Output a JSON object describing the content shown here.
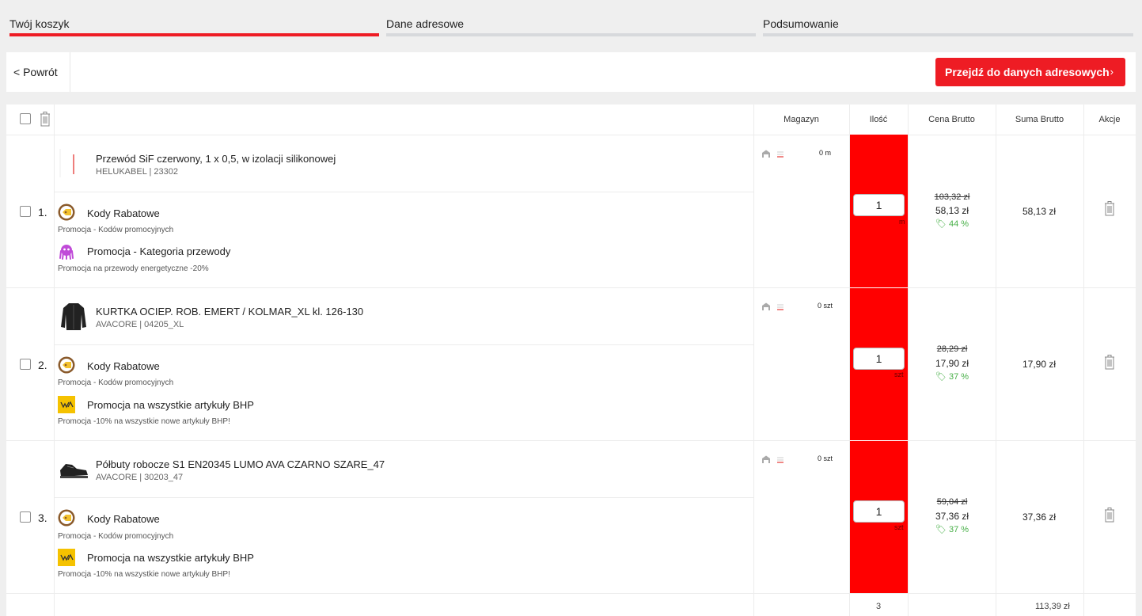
{
  "steps": [
    {
      "label": "Twój koszyk",
      "active": true
    },
    {
      "label": "Dane adresowe",
      "active": false
    },
    {
      "label": "Podsumowanie",
      "active": false
    }
  ],
  "toolbar": {
    "back_label": "< Powrót",
    "next_label": "Przejdź do danych adresowych",
    "next_icon": "chevron-right-icon"
  },
  "table": {
    "headers": {
      "stock": "Magazyn",
      "qty": "Ilość",
      "price": "Cena Brutto",
      "sum": "Suma Brutto",
      "actions": "Akcje"
    },
    "rows": [
      {
        "num": "1.",
        "name": "Przewód SiF czerwony, 1 x 0,5, w izolacji silikonowej",
        "sub": "HELUKABEL | 23302",
        "thumb": "red-cable",
        "stock": "0 m",
        "promos": [
          {
            "title": "Kody Rabatowe",
            "sub": "Promocja - Kodów promocyjnych",
            "icon": "coupon-icon"
          },
          {
            "title": "Promocja - Kategoria przewody",
            "sub": "Promocja na przewody energetyczne -20%",
            "icon": "octopus-icon"
          }
        ],
        "qty": "1",
        "unit": "m",
        "old_price": "103,32 zł",
        "price": "58,13 zł",
        "discount": "44 %",
        "sum": "58,13 zł"
      },
      {
        "num": "2.",
        "name": "KURTKA OCIEP. ROB. EMERT / KOLMAR_XL kl. 126-130",
        "sub": "AVACORE | 04205_XL",
        "thumb": "black-jacket",
        "stock": "0 szt",
        "promos": [
          {
            "title": "Kody Rabatowe",
            "sub": "Promocja - Kodów promocyjnych",
            "icon": "coupon-icon"
          },
          {
            "title": "Promocja na wszystkie artykuły BHP",
            "sub": "Promocja -10% na wszystkie nowe artykuły BHP!",
            "icon": "bhp-icon"
          }
        ],
        "qty": "1",
        "unit": "szt",
        "old_price": "28,29 zł",
        "price": "17,90 zł",
        "discount": "37 %",
        "sum": "17,90 zł"
      },
      {
        "num": "3.",
        "name": "Półbuty robocze S1 EN20345 LUMO AVA CZARNO SZARE_47",
        "sub": "AVACORE | 30203_47",
        "thumb": "black-shoe",
        "stock": "0 szt",
        "promos": [
          {
            "title": "Kody Rabatowe",
            "sub": "Promocja - Kodów promocyjnych",
            "icon": "coupon-icon"
          },
          {
            "title": "Promocja na wszystkie artykuły BHP",
            "sub": "Promocja -10% na wszystkie nowe artykuły BHP!",
            "icon": "bhp-icon"
          }
        ],
        "qty": "1",
        "unit": "szt",
        "old_price": "59,04 zł",
        "price": "37,36 zł",
        "discount": "37 %",
        "sum": "37,36 zł"
      }
    ],
    "footer": {
      "qty_total": "3",
      "sum_total": "113,39 zł"
    }
  },
  "colors": {
    "accent": "#ee1c24",
    "qty_column": "#ff0000",
    "discount": "#49b049"
  }
}
